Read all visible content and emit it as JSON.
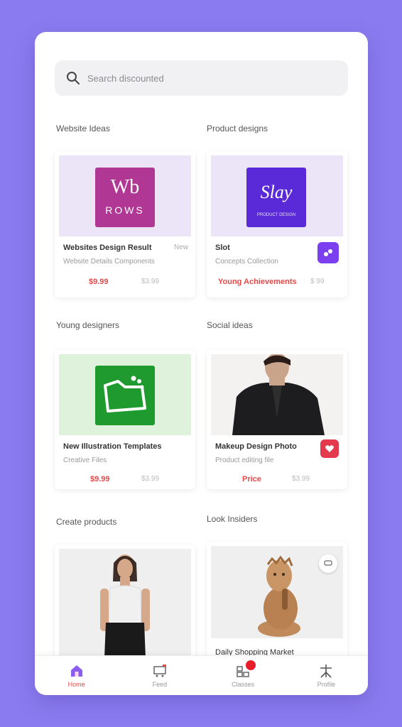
{
  "search": {
    "placeholder": "Search discounted"
  },
  "sections": [
    {
      "title": "Website Ideas"
    },
    {
      "title": "Product designs"
    },
    {
      "title": "Young designers"
    },
    {
      "title": "Social ideas"
    },
    {
      "title": "Create products"
    },
    {
      "title": "Look Insiders"
    }
  ],
  "cards": [
    {
      "logo_line1": "Wb",
      "logo_line2": "ROWS",
      "name": "Websites Design Result",
      "tag": "New",
      "sub": "Website Details Components",
      "price": "$9.99",
      "old": "$3.99",
      "bg": "#ece4f7",
      "logo_bg": "#b13795"
    },
    {
      "logo_line1": "Slay",
      "logo_line2": "PRODUCT DESIGN",
      "name": "Slot",
      "sub": "Concepts Collection",
      "price": "Young Achievements",
      "old": "$ 99",
      "bg": "#ece4f7",
      "logo_bg": "#5b2ad8",
      "badge_color": "#7b3ff0"
    },
    {
      "name": "New Illustration Templates",
      "sub": "Creative Files",
      "price": "$9.99",
      "old": "$3.99",
      "bg": "#dff2dc",
      "logo_bg": "#1f9a2f"
    },
    {
      "name": "Makeup Design Photo",
      "sub": "Product editing file",
      "price": "Price",
      "old": "$3.99",
      "bg": "#f4f2f0",
      "badge_color": "#e33a4d"
    },
    {
      "name": "",
      "sub": "",
      "bg": "#efefef"
    },
    {
      "name": "Daily Shopping Market",
      "sub": "",
      "bg": "#efefef"
    }
  ],
  "nav": [
    {
      "label": "Home",
      "icon": "home-icon",
      "active": true
    },
    {
      "label": "Feed",
      "icon": "cart-icon"
    },
    {
      "label": "Classes",
      "icon": "grid-icon"
    },
    {
      "label": "Profile",
      "icon": "person-icon"
    }
  ],
  "colors": {
    "accent": "#8a7cf0",
    "sale": "#e24a4a",
    "notif": "#e81d2a"
  }
}
